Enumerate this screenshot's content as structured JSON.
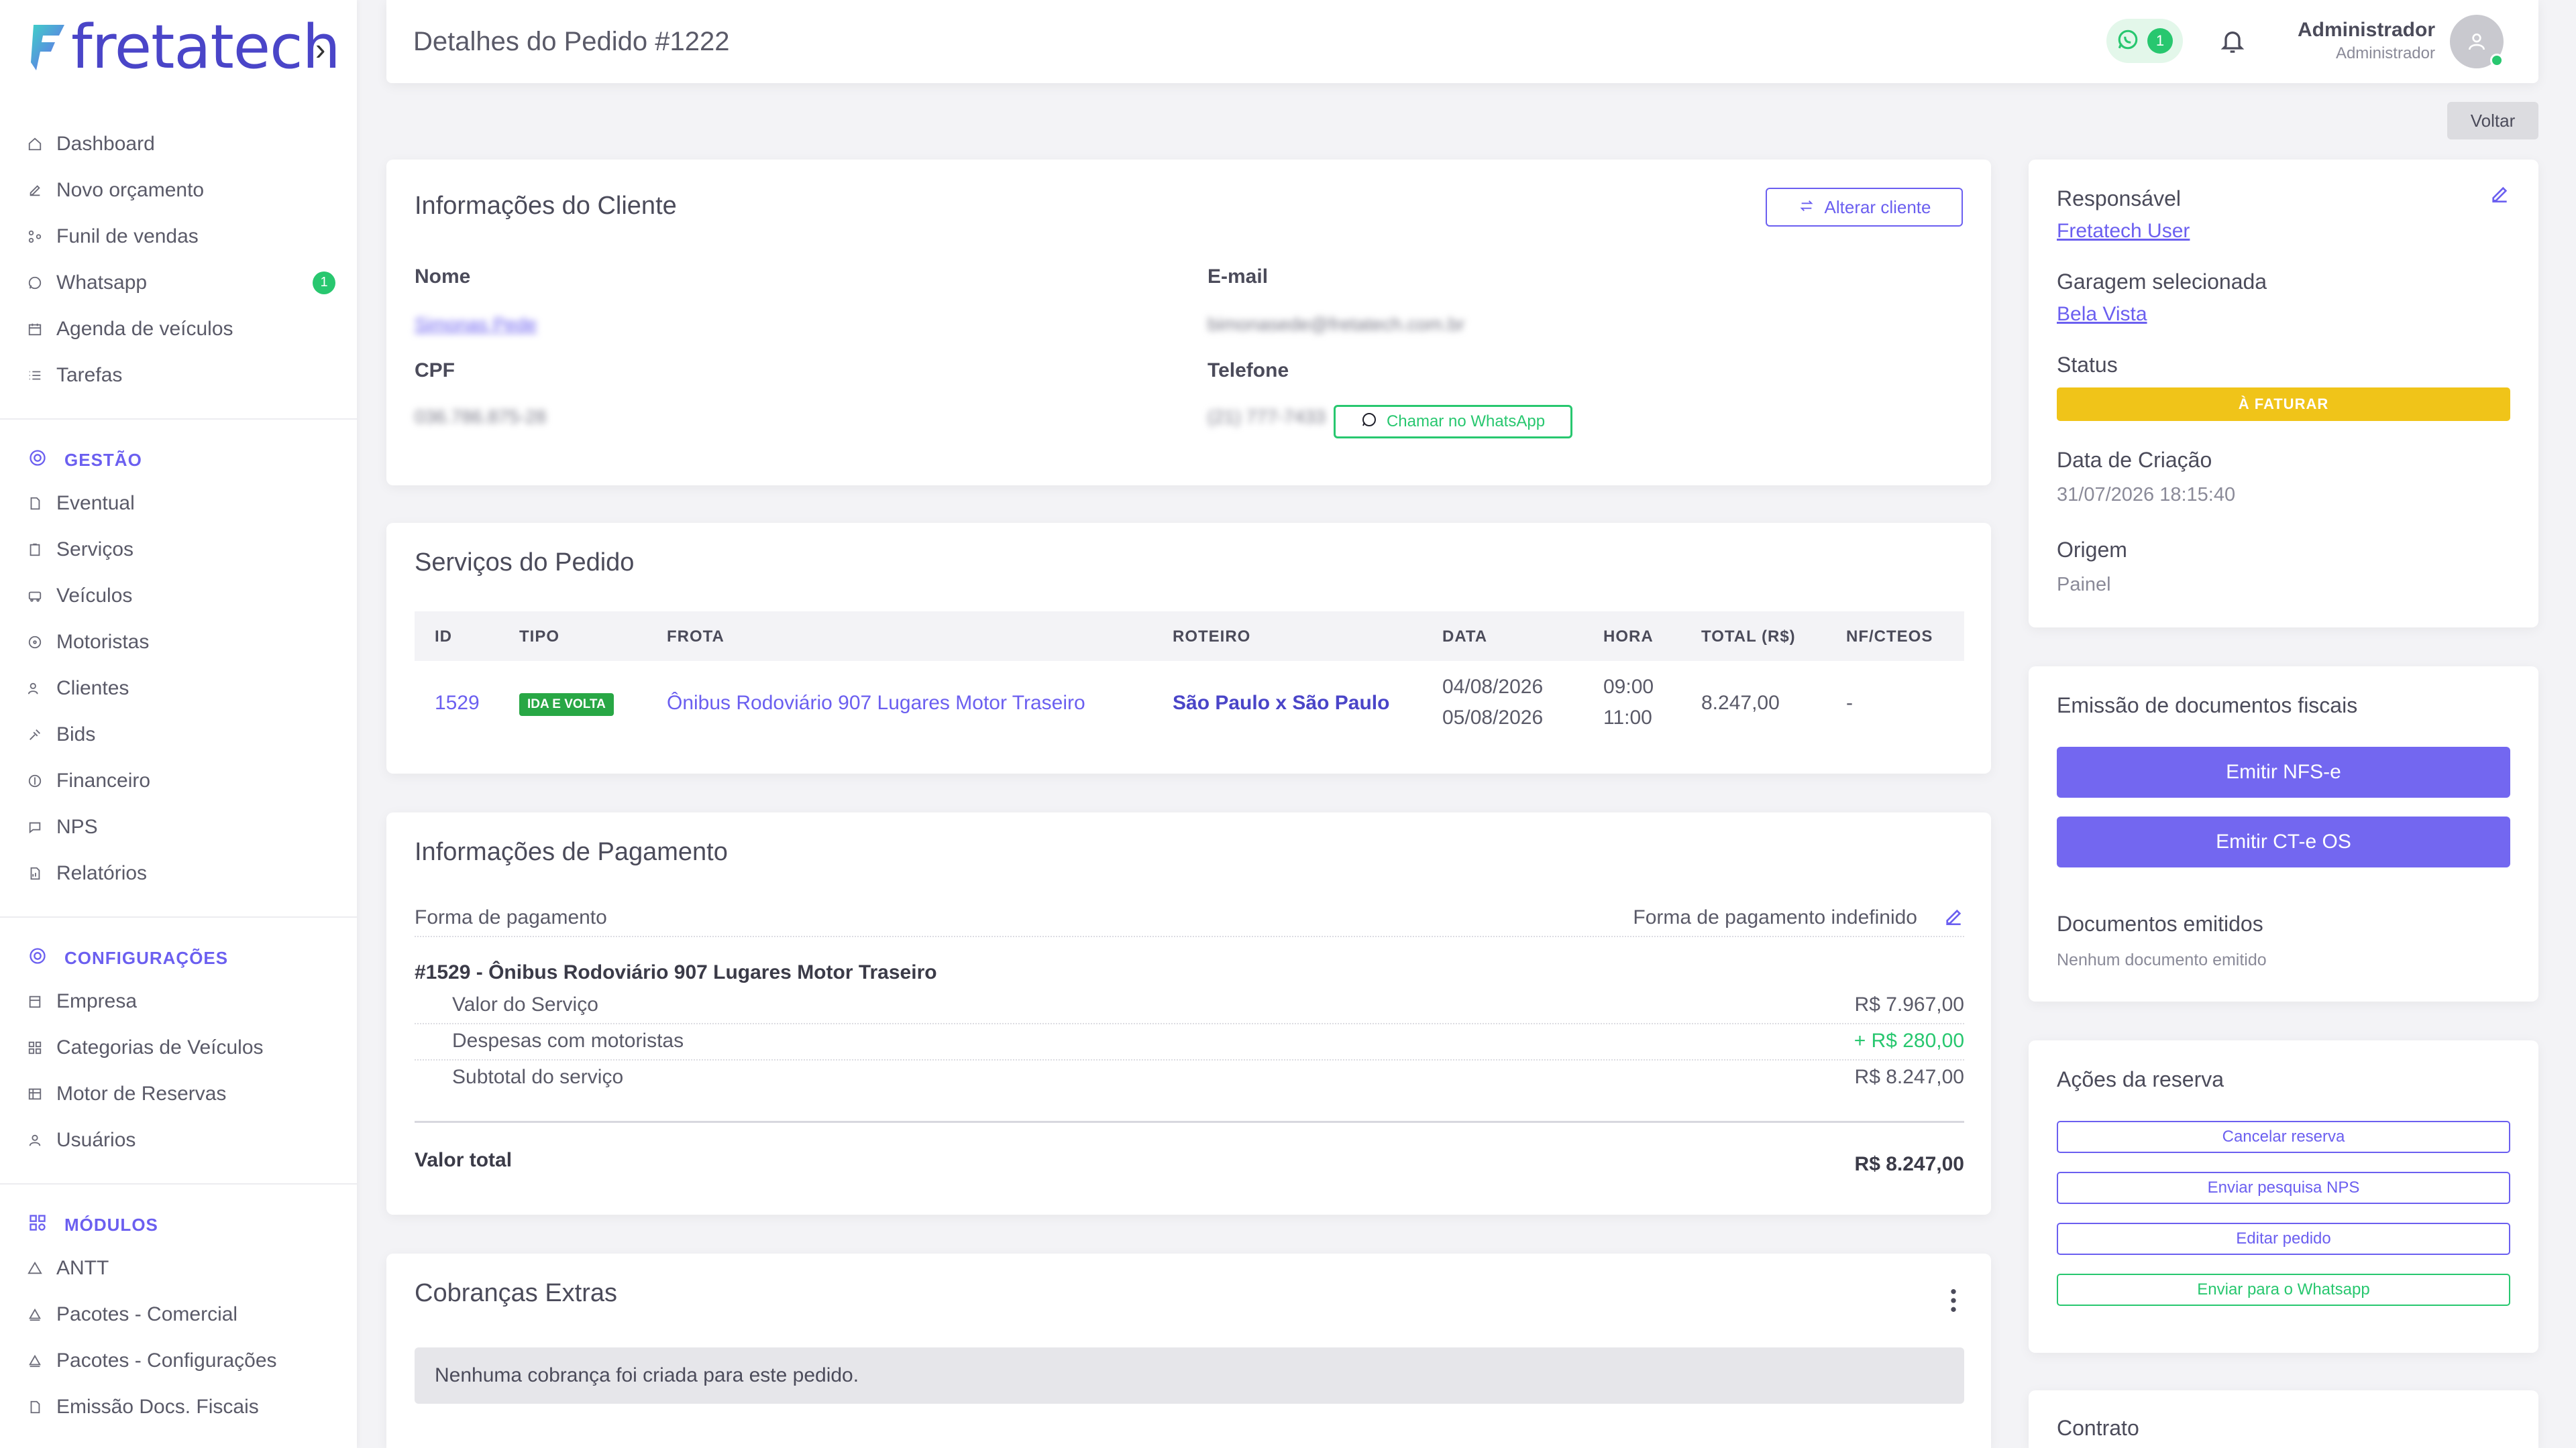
{
  "brand": {
    "name": "fretatech",
    "accent": "#6b5ff0",
    "success": "#28c76f",
    "warning": "#f0c419"
  },
  "sidebar": {
    "main_items": [
      {
        "label": "Dashboard",
        "icon": "home-icon"
      },
      {
        "label": "Novo orçamento",
        "icon": "edit-icon"
      },
      {
        "label": "Funil de vendas",
        "icon": "funnel-icon"
      },
      {
        "label": "Whatsapp",
        "icon": "whatsapp-icon",
        "badge": "1"
      },
      {
        "label": "Agenda de veículos",
        "icon": "calendar-icon"
      },
      {
        "label": "Tarefas",
        "icon": "list-icon"
      }
    ],
    "gestao_title": "GESTÃO",
    "gestao_items": [
      {
        "label": "Eventual",
        "icon": "file-icon"
      },
      {
        "label": "Serviços",
        "icon": "clipboard-icon"
      },
      {
        "label": "Veículos",
        "icon": "bus-icon"
      },
      {
        "label": "Motoristas",
        "icon": "steering-icon"
      },
      {
        "label": "Clientes",
        "icon": "users-icon"
      },
      {
        "label": "Bids",
        "icon": "gavel-icon"
      },
      {
        "label": "Financeiro",
        "icon": "dollar-icon"
      },
      {
        "label": "NPS",
        "icon": "chat-icon"
      },
      {
        "label": "Relatórios",
        "icon": "report-icon"
      }
    ],
    "config_title": "CONFIGURAÇÕES",
    "config_items": [
      {
        "label": "Empresa",
        "icon": "building-icon"
      },
      {
        "label": "Categorias de Veículos",
        "icon": "grid-icon"
      },
      {
        "label": "Motor de Reservas",
        "icon": "table-icon"
      },
      {
        "label": "Usuários",
        "icon": "user-icon"
      }
    ],
    "modulos_title": "MÓDULOS",
    "modulos_items": [
      {
        "label": "ANTT",
        "icon": "triangle-icon"
      },
      {
        "label": "Pacotes - Comercial",
        "icon": "package-icon"
      },
      {
        "label": "Pacotes - Configurações",
        "icon": "package-config-icon"
      },
      {
        "label": "Emissão Docs. Fiscais",
        "icon": "document-icon"
      }
    ]
  },
  "header": {
    "title": "Detalhes do Pedido #1222",
    "whatsapp_count": "1",
    "user_name": "Administrador",
    "user_role": "Administrador"
  },
  "voltar_label": "Voltar",
  "cliente": {
    "title": "Informações do Cliente",
    "alterar_label": "Alterar cliente",
    "nome_label": "Nome",
    "nome_value": "Simonas Pede",
    "email_label": "E-mail",
    "email_value": "bimonasede@fretatech.com.br",
    "cpf_label": "CPF",
    "cpf_value": "036.786.875-28",
    "telefone_label": "Telefone",
    "telefone_value": "(21) 777-7433",
    "whatsapp_btn": "Chamar no WhatsApp"
  },
  "servicos": {
    "title": "Serviços do Pedido",
    "columns": [
      "ID",
      "TIPO",
      "FROTA",
      "ROTEIRO",
      "DATA",
      "HORA",
      "TOTAL (R$)",
      "NF/CTEOS"
    ],
    "rows": [
      {
        "id": "1529",
        "tipo": "IDA E VOLTA",
        "frota": "Ônibus Rodoviário 907 Lugares Motor Traseiro",
        "roteiro": "São Paulo x São Paulo",
        "data_ida": "04/08/2026",
        "data_volta": "05/08/2026",
        "hora_ida": "09:00",
        "hora_volta": "11:00",
        "total": "8.247,00",
        "nf": "-"
      }
    ]
  },
  "pagamento": {
    "title": "Informações de Pagamento",
    "forma_label": "Forma de pagamento",
    "forma_value": "Forma de pagamento indefinido",
    "servico_title": "#1529 - Ônibus Rodoviário 907 Lugares Motor Traseiro",
    "valor_servico_label": "Valor do Serviço",
    "valor_servico": "R$ 7.967,00",
    "despesas_label": "Despesas com motoristas",
    "despesas": "+ R$ 280,00",
    "subtotal_label": "Subtotal do serviço",
    "subtotal": "R$ 8.247,00",
    "total_label": "Valor total",
    "total": "R$ 8.247,00"
  },
  "cobrancas": {
    "title": "Cobranças Extras",
    "empty": "Nenhuma cobrança foi criada para este pedido."
  },
  "responsavel": {
    "label": "Responsável",
    "value": "Fretatech User",
    "garagem_label": "Garagem selecionada",
    "garagem_value": "Bela Vista",
    "status_label": "Status",
    "status_value": "À FATURAR",
    "criacao_label": "Data de Criação",
    "criacao_value": "31/07/2026 18:15:40",
    "origem_label": "Origem",
    "origem_value": "Painel"
  },
  "fiscais": {
    "title": "Emissão de documentos fiscais",
    "nfse_label": "Emitir NFS-e",
    "cte_label": "Emitir CT-e OS",
    "docs_title": "Documentos emitidos",
    "docs_empty": "Nenhum documento emitido"
  },
  "acoes": {
    "title": "Ações da reserva",
    "cancelar": "Cancelar reserva",
    "nps": "Enviar pesquisa NPS",
    "editar": "Editar pedido",
    "whatsapp": "Enviar para o Whatsapp"
  },
  "contrato": {
    "title": "Contrato"
  }
}
